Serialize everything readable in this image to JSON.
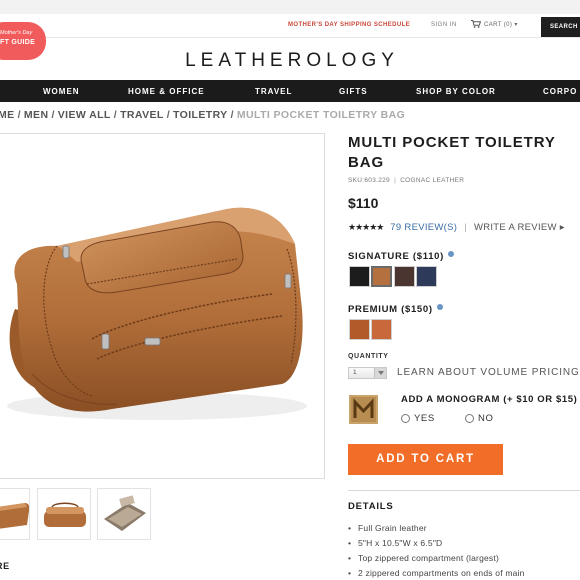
{
  "header": {
    "promo_link": "MOTHER'S DAY SHIPPING SCHEDULE",
    "sign_in": "SIGN IN",
    "cart_label": "CART (0) ▾",
    "cart_icon": "shopping-cart-icon",
    "search_label": "SEARCH",
    "badge_line1": "Mother's Day",
    "badge_line2": "FT GUIDE",
    "badge_color": "#f15b5b",
    "logo": "LEATHEROLOGY"
  },
  "nav": {
    "items": [
      "WOMEN",
      "HOME & OFFICE",
      "TRAVEL",
      "GIFTS",
      "SHOP BY COLOR",
      "CORPO"
    ]
  },
  "breadcrumb": {
    "items": [
      "ME",
      "MEN",
      "VIEW ALL",
      "TRAVEL",
      "TOILETRY"
    ],
    "separator": "/",
    "current": "MULTI POCKET TOILETRY BAG"
  },
  "product": {
    "title": "MULTI POCKET TOILETRY BAG",
    "sku_text": "SKU:603.229",
    "sku_sep": "|",
    "color_name": "COGNAC LEATHER",
    "price": "$110",
    "stars": "★★★★★",
    "rating": 5,
    "review_count_text": "79 REVIEW(S)",
    "review_sep": "|",
    "write_review": "WRITE A REVIEW ▸"
  },
  "options": {
    "signature_label": "SIGNATURE ($110)",
    "signature_swatches": [
      "#1c1c1c",
      "#b5703f",
      "#4a3531",
      "#2e3a5a"
    ],
    "signature_selected": 1,
    "premium_label": "PREMIUM ($150)",
    "premium_swatches": [
      "#b25a2a",
      "#c9683a"
    ],
    "info_icon": "info-icon"
  },
  "quantity": {
    "label": "QUANTITY",
    "value": "1",
    "volume_link": "LEARN ABOUT VOLUME PRICING"
  },
  "monogram": {
    "label": "ADD A MONOGRAM (+ $10 OR $15)",
    "yes": "YES",
    "no": "NO",
    "icon": "monogram-m-icon"
  },
  "cta": {
    "add_to_cart": "ADD TO CART",
    "color": "#f26d27"
  },
  "details": {
    "title": "DETAILS",
    "items": [
      "Full Grain leather",
      "5\"H x 10.5\"W x 6.5\"D",
      "Top zippered compartment (largest)",
      "2 zippered compartments on ends of main"
    ]
  },
  "bottom_left": "RE"
}
